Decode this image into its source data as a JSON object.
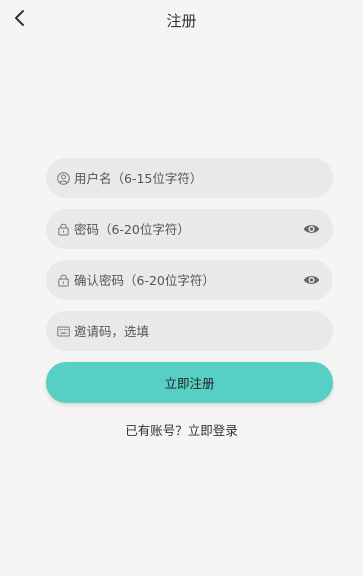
{
  "header": {
    "title": "注册",
    "back_icon": "chevron-left-icon"
  },
  "form": {
    "username": {
      "placeholder": "用户名（6-15位字符）",
      "value": "",
      "icon": "user-icon"
    },
    "password": {
      "placeholder": "密码（6-20位字符）",
      "value": "",
      "icon": "lock-icon",
      "toggle_icon": "eye-icon"
    },
    "confirm_password": {
      "placeholder": "确认密码（6-20位字符）",
      "value": "",
      "icon": "lock-icon",
      "toggle_icon": "eye-icon"
    },
    "invite_code": {
      "placeholder": "邀请码，选填",
      "value": "",
      "icon": "keyboard-icon"
    }
  },
  "submit": {
    "label": "立即注册"
  },
  "footer": {
    "login_text": "已有账号？立即登录"
  },
  "colors": {
    "background": "#f5f5f5",
    "field_bg": "#e9e9e9",
    "accent": "#58cfc4"
  }
}
